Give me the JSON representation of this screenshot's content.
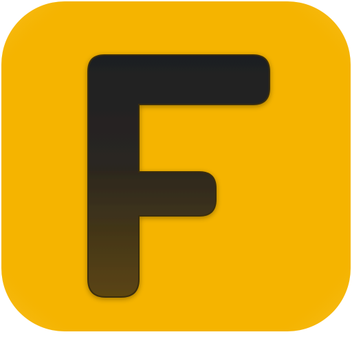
{
  "icon": {
    "name": "f-app-icon",
    "glyph": "F",
    "colors": {
      "tile": "#F5B400",
      "tile_edge": "#F8C22E",
      "glyph_top": "#1E1F22",
      "glyph_bottom": "#5C4511",
      "glyph_outline": "#3A2E10"
    }
  }
}
